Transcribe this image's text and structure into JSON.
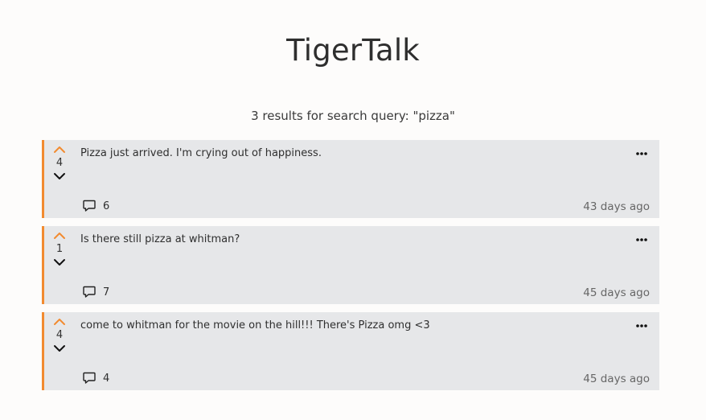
{
  "app": {
    "title": "TigerTalk"
  },
  "search": {
    "summary": "3 results for search query: \"pizza\""
  },
  "colors": {
    "accent": "#f28b30",
    "card_bg": "#e6e7e9",
    "page_bg": "#fdfcfb"
  },
  "icons": {
    "upvote": "chevron-up-icon",
    "downvote": "chevron-down-icon",
    "more": "more-options-icon",
    "comment": "speech-bubble-icon"
  },
  "posts": [
    {
      "votes": "4",
      "text": "Pizza just arrived. I'm crying out of happiness.",
      "comments": "6",
      "time": "43 days ago"
    },
    {
      "votes": "1",
      "text": "Is there still pizza at whitman?",
      "comments": "7",
      "time": "45 days ago"
    },
    {
      "votes": "4",
      "text": "come to whitman for the movie on the hill!!! There's Pizza omg <3",
      "comments": "4",
      "time": "45 days ago"
    }
  ]
}
